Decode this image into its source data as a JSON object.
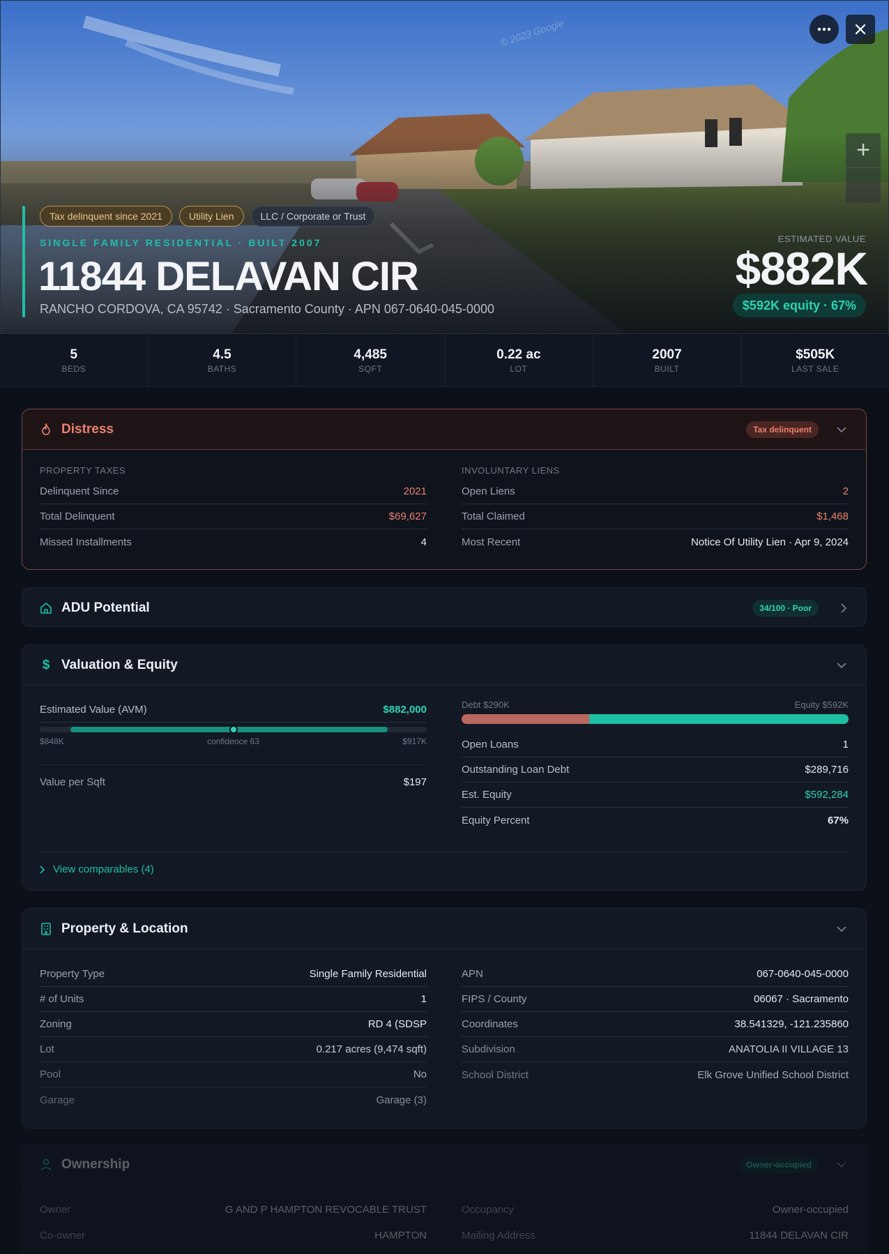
{
  "hero": {
    "watermark": "© 2023 Google",
    "badges": [
      "Tax delinquent since 2021",
      "Utility Lien",
      "LLC / Corporate or Trust"
    ],
    "subtitle": "SINGLE FAMILY RESIDENTIAL · BUILT 2007",
    "address": "11844 DELAVAN CIR",
    "location": "RANCHO CORDOVA, CA 95742 · Sacramento County · APN 067-0640-045-0000",
    "estimated_label": "ESTIMATED VALUE",
    "estimated_value": "$882K",
    "equity_pill": "$592K equity · 67%",
    "more_icon": "more-horizontal-icon",
    "close_icon": "close-icon",
    "zoom_in_icon": "plus-icon"
  },
  "stats": [
    {
      "value": "5",
      "label": "BEDS"
    },
    {
      "value": "4.5",
      "label": "BATHS"
    },
    {
      "value": "4,485",
      "label": "SQFT"
    },
    {
      "value": "0.22 ac",
      "label": "LOT"
    },
    {
      "value": "2007",
      "label": "BUILT"
    },
    {
      "value": "$505K",
      "label": "LAST SALE"
    }
  ],
  "distress": {
    "title": "Distress",
    "badge": "Tax delinquent",
    "left": {
      "label": "PROPERTY TAXES",
      "rows": [
        {
          "k": "Delinquent Since",
          "v": "2021"
        },
        {
          "k": "Total Delinquent",
          "v": "$69,627"
        },
        {
          "k": "Missed Installments",
          "v": "4"
        }
      ]
    },
    "right": {
      "label": "INVOLUNTARY LIENS",
      "rows": [
        {
          "k": "Open Liens",
          "v": "2"
        },
        {
          "k": "Total Claimed",
          "v": "$1,468"
        },
        {
          "k": "Most Recent",
          "v": "Notice Of Utility Lien · Apr 9, 2024"
        }
      ]
    }
  },
  "adu": {
    "title": "ADU Potential",
    "badge": "34/100 · Poor"
  },
  "valuation": {
    "title": "Valuation & Equity",
    "avm_label": "Estimated Value (AVM)",
    "avm_value": "$882,000",
    "avm_confidence_position": 0.5,
    "avm_low": "$848K",
    "avm_confidence": "confidence 63",
    "avm_high": "$917K",
    "vps_label": "Value per Sqft",
    "vps_value": "$197",
    "debt_label": "Debt $290K",
    "equity_label": "Equity $592K",
    "debt_fraction": 0.33,
    "rows": [
      {
        "k": "Open Loans",
        "v": "1"
      },
      {
        "k": "Outstanding Loan Debt",
        "v": "$289,716"
      },
      {
        "k": "Est. Equity",
        "v": "$592,284"
      },
      {
        "k": "Equity Percent",
        "v": "67%"
      }
    ],
    "comps": "View comparables (4)"
  },
  "property": {
    "title": "Property & Location",
    "left": [
      {
        "k": "Property Type",
        "v": "Single Family Residential"
      },
      {
        "k": "# of Units",
        "v": "1"
      },
      {
        "k": "Zoning",
        "v": "RD 4 (SDSP"
      },
      {
        "k": "Lot",
        "v": "0.217 acres (9,474 sqft)"
      },
      {
        "k": "Pool",
        "v": "No"
      },
      {
        "k": "Garage",
        "v": "Garage (3)"
      }
    ],
    "right": [
      {
        "k": "APN",
        "v": "067-0640-045-0000"
      },
      {
        "k": "FIPS / County",
        "v": "06067 · Sacramento"
      },
      {
        "k": "Coordinates",
        "v": "38.541329, -121.235860"
      },
      {
        "k": "Subdivision",
        "v": "ANATOLIA II VILLAGE 13"
      },
      {
        "k": "School District",
        "v": "Elk Grove Unified School District"
      }
    ]
  },
  "ownership": {
    "title": "Ownership",
    "badge": "Owner-occupied",
    "left": [
      {
        "k": "Owner",
        "v": "G AND P HAMPTON REVOCABLE TRUST"
      },
      {
        "k": "Co-owner",
        "v": "HAMPTON"
      }
    ],
    "right": [
      {
        "k": "Occupancy",
        "v": "Owner-occupied"
      },
      {
        "k": "Mailing Address",
        "v": "11844 DELAVAN CIR"
      }
    ]
  }
}
